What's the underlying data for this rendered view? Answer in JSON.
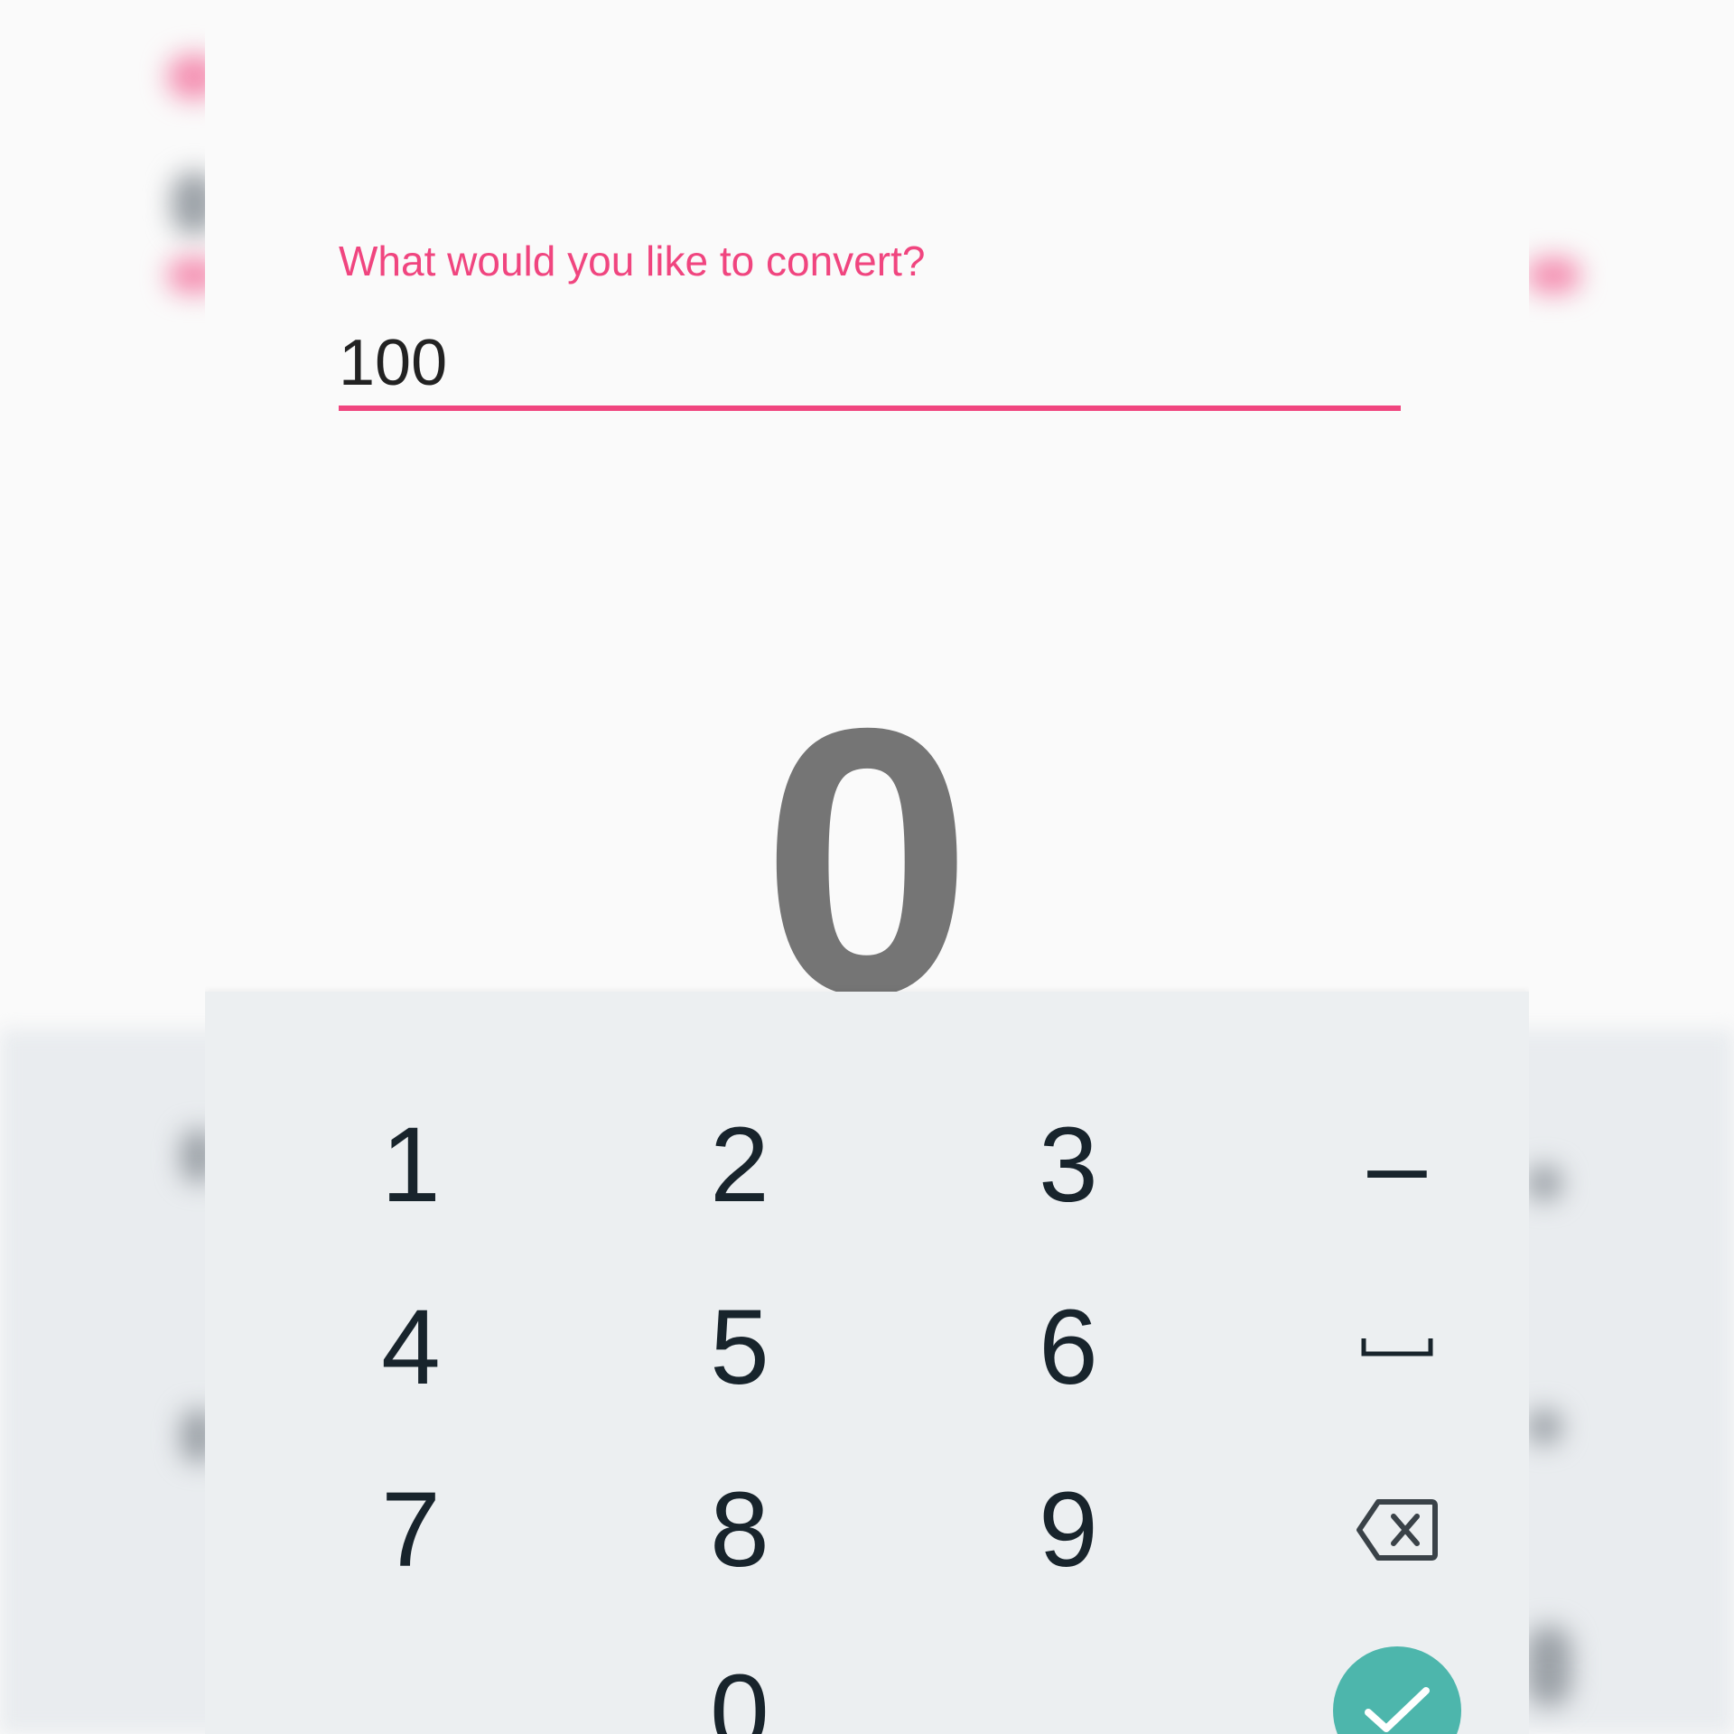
{
  "converter": {
    "prompt_label": "What would you like to convert?",
    "input_value": "100",
    "result_value": "0"
  },
  "keyboard": {
    "row1": [
      "1",
      "2",
      "3",
      "–"
    ],
    "row2": [
      "4",
      "5",
      "6"
    ],
    "row3": [
      "7",
      "8",
      "9"
    ],
    "row4": [
      ",",
      "0",
      "."
    ],
    "space_icon": "space-icon",
    "backspace_icon": "backspace-icon",
    "done_icon": "checkmark-icon"
  },
  "colors": {
    "accent": "#f0457f",
    "done_button": "#4db6ac",
    "keyboard_bg": "#eceff1",
    "key_text": "#18242c",
    "result_text": "#757575"
  }
}
